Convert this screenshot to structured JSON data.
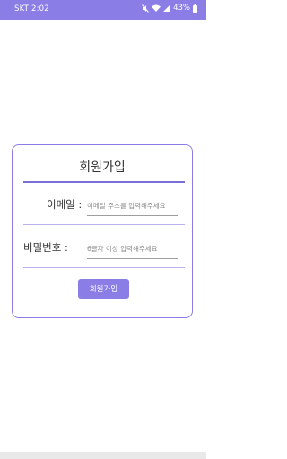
{
  "status_bar": {
    "carrier_time": "SKT  2:02",
    "battery": "43%",
    "icons": [
      "mute-icon",
      "wifi-icon",
      "signal-icon",
      "battery-icon"
    ]
  },
  "form": {
    "title": "회원가입",
    "email_label": "이메일 :",
    "email_placeholder": "이메일 주소를 입력해주세요",
    "email_value": "",
    "password_label": "비밀번호 :",
    "password_placeholder": "6글자 이상 입력해주세요",
    "password_value": "",
    "submit_label": "회원가입"
  },
  "colors": {
    "accent": "#8a7ee6",
    "status_bar": "#8a7ee6"
  }
}
